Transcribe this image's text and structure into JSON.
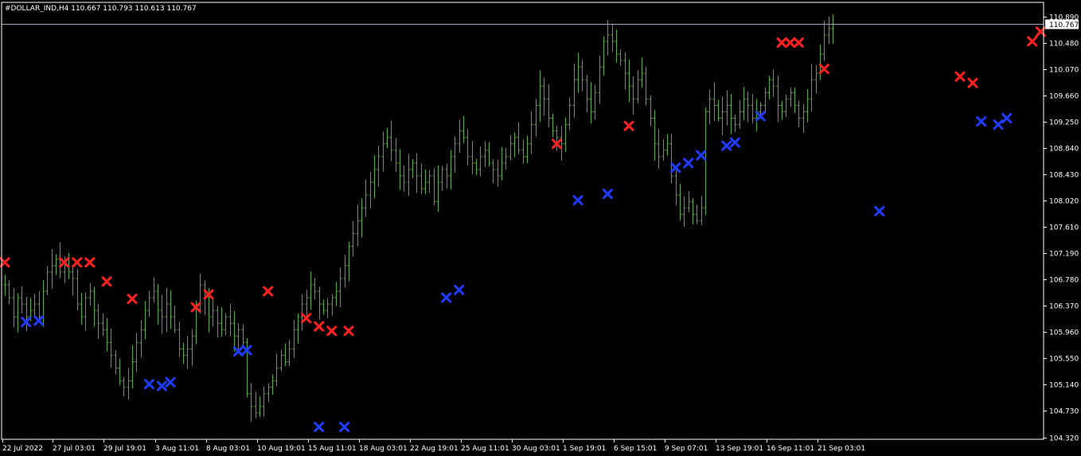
{
  "header": {
    "symbol_info": "#DOLLAR_IND,H4  110.667 110.793 110.613 110.767"
  },
  "price_marker": {
    "label": "110.767",
    "value": 110.767
  },
  "colors": {
    "background": "#000000",
    "bars": "#4caf2a",
    "axis": "#ffffff",
    "sell_marker": "#ff2020",
    "buy_marker": "#1f3bff",
    "price_line": "#9aa0c8"
  },
  "chart_data": {
    "type": "ohlc",
    "ylim": [
      104.32,
      110.89
    ],
    "y_ticks": [
      "110.890",
      "110.480",
      "110.070",
      "109.660",
      "109.250",
      "108.840",
      "108.430",
      "108.020",
      "107.610",
      "107.190",
      "106.780",
      "106.370",
      "105.960",
      "105.550",
      "105.140",
      "104.730",
      "104.320"
    ],
    "y_tick_values": [
      110.89,
      110.48,
      110.07,
      109.66,
      109.25,
      108.84,
      108.43,
      108.02,
      107.61,
      107.19,
      106.78,
      106.37,
      105.96,
      105.55,
      105.14,
      104.73,
      104.32
    ],
    "x_ticks": [
      "22 Jul 2022",
      "27 Jul 03:01",
      "29 Jul 19:01",
      "3 Aug 11:01",
      "8 Aug 03:01",
      "10 Aug 19:01",
      "15 Aug 11:01",
      "18 Aug 03:01",
      "22 Aug 19:01",
      "25 Aug 11:01",
      "30 Aug 03:01",
      "1 Sep 19:01",
      "6 Sep 15:01",
      "9 Sep 07:01",
      "13 Sep 19:01",
      "16 Sep 11:01",
      "21 Sep 03:01"
    ],
    "closes": [
      106.7,
      106.5,
      106.2,
      106.5,
      106.4,
      106.2,
      106.3,
      106.4,
      106.2,
      106.6,
      106.9,
      107.0,
      107.1,
      106.9,
      107.0,
      106.9,
      106.8,
      106.4,
      106.2,
      106.5,
      106.6,
      106.3,
      106.1,
      106.0,
      105.8,
      105.6,
      105.4,
      105.2,
      105.1,
      105.2,
      105.5,
      105.8,
      106.0,
      106.3,
      106.5,
      106.6,
      106.3,
      106.2,
      106.4,
      106.2,
      106.0,
      105.7,
      105.6,
      105.7,
      105.9,
      106.4,
      106.7,
      106.5,
      106.2,
      106.3,
      106.1,
      106.0,
      106.2,
      106.1,
      105.9,
      106.0,
      105.8,
      105.0,
      104.8,
      104.7,
      104.8,
      105.0,
      105.1,
      105.2,
      105.4,
      105.6,
      105.5,
      105.7,
      106.0,
      106.2,
      106.4,
      106.5,
      106.7,
      106.6,
      106.4,
      106.3,
      106.4,
      106.5,
      106.6,
      106.8,
      107.0,
      107.3,
      107.5,
      107.7,
      107.9,
      108.1,
      108.3,
      108.5,
      108.7,
      108.9,
      109.0,
      108.8,
      108.6,
      108.4,
      108.3,
      108.5,
      108.6,
      108.4,
      108.2,
      108.3,
      108.4,
      108.0,
      108.3,
      108.5,
      108.4,
      108.7,
      108.9,
      109.1,
      109.0,
      108.7,
      108.6,
      108.5,
      108.7,
      108.8,
      108.6,
      108.5,
      108.4,
      108.6,
      108.7,
      108.9,
      109.0,
      108.8,
      108.7,
      108.9,
      109.2,
      109.5,
      109.8,
      109.6,
      109.3,
      109.1,
      109.0,
      108.9,
      109.2,
      109.5,
      109.9,
      110.1,
      109.9,
      109.6,
      109.4,
      109.7,
      110.1,
      110.5,
      110.6,
      110.5,
      110.3,
      110.2,
      110.0,
      109.8,
      109.6,
      109.9,
      110.0,
      109.6,
      109.3,
      108.9,
      108.7,
      108.8,
      108.9,
      108.4,
      108.1,
      107.8,
      107.9,
      108.0,
      107.8,
      107.7,
      107.9,
      109.4,
      109.6,
      109.5,
      109.3,
      109.4,
      109.5,
      109.3,
      109.2,
      109.4,
      109.6,
      109.5,
      109.3,
      109.4,
      109.5,
      109.7,
      109.9,
      109.8,
      109.5,
      109.4,
      109.6,
      109.7,
      109.5,
      109.3,
      109.4,
      109.6,
      109.9,
      110.0,
      110.3,
      110.6,
      110.7,
      110.77
    ],
    "sell_signals": [
      {
        "i": 0,
        "v": 107.05
      },
      {
        "i": 14,
        "v": 107.05
      },
      {
        "i": 17,
        "v": 107.05
      },
      {
        "i": 20,
        "v": 107.05
      },
      {
        "i": 24,
        "v": 106.75
      },
      {
        "i": 30,
        "v": 106.48
      },
      {
        "i": 45,
        "v": 106.35
      },
      {
        "i": 48,
        "v": 106.55
      },
      {
        "i": 62,
        "v": 106.6
      },
      {
        "i": 71,
        "v": 106.18
      },
      {
        "i": 74,
        "v": 106.05
      },
      {
        "i": 77,
        "v": 105.98
      },
      {
        "i": 81,
        "v": 105.98
      },
      {
        "i": 130,
        "v": 108.9
      },
      {
        "i": 147,
        "v": 109.18
      },
      {
        "i": 183,
        "v": 110.48
      },
      {
        "i": 185,
        "v": 110.48
      },
      {
        "i": 187,
        "v": 110.48
      },
      {
        "i": 193,
        "v": 110.07
      },
      {
        "i": 225,
        "v": 109.95
      },
      {
        "i": 228,
        "v": 109.85
      },
      {
        "i": 242,
        "v": 110.5
      },
      {
        "i": 244,
        "v": 110.65
      }
    ],
    "buy_signals": [
      {
        "i": 5,
        "v": 106.12
      },
      {
        "i": 8,
        "v": 106.14
      },
      {
        "i": 34,
        "v": 105.15
      },
      {
        "i": 37,
        "v": 105.12
      },
      {
        "i": 39,
        "v": 105.18
      },
      {
        "i": 55,
        "v": 105.66
      },
      {
        "i": 57,
        "v": 105.68
      },
      {
        "i": 74,
        "v": 104.48
      },
      {
        "i": 80,
        "v": 104.48
      },
      {
        "i": 104,
        "v": 106.5
      },
      {
        "i": 107,
        "v": 106.62
      },
      {
        "i": 135,
        "v": 108.02
      },
      {
        "i": 142,
        "v": 108.12
      },
      {
        "i": 158,
        "v": 108.53
      },
      {
        "i": 161,
        "v": 108.6
      },
      {
        "i": 164,
        "v": 108.72
      },
      {
        "i": 170,
        "v": 108.87
      },
      {
        "i": 172,
        "v": 108.92
      },
      {
        "i": 178,
        "v": 109.33
      },
      {
        "i": 206,
        "v": 107.85
      },
      {
        "i": 230,
        "v": 109.25
      },
      {
        "i": 234,
        "v": 109.2
      },
      {
        "i": 236,
        "v": 109.3
      }
    ]
  }
}
